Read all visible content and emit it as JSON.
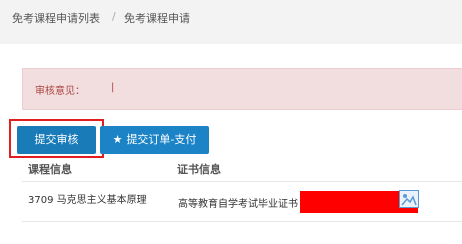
{
  "breadcrumb": {
    "items": [
      "免考课程申请列表",
      "免考课程申请"
    ],
    "separator": "/"
  },
  "alert": {
    "label": "审核意见：",
    "value": "|"
  },
  "actions": {
    "submit_review": "提交审核",
    "submit_pay": "提交订单-支付",
    "pay_icon": "★"
  },
  "table": {
    "headers": [
      "课程信息",
      "证书信息"
    ],
    "rows": [
      {
        "course": "3709 马克思主义基本原理",
        "certificate": "高等教育自学考试毕业证书"
      }
    ]
  },
  "icons": {
    "certificate_image": "image-icon"
  },
  "colors": {
    "primary": "#1c84c6",
    "alert_bg": "#f2dede",
    "alert_text": "#a94442",
    "highlight": "#e02020"
  }
}
